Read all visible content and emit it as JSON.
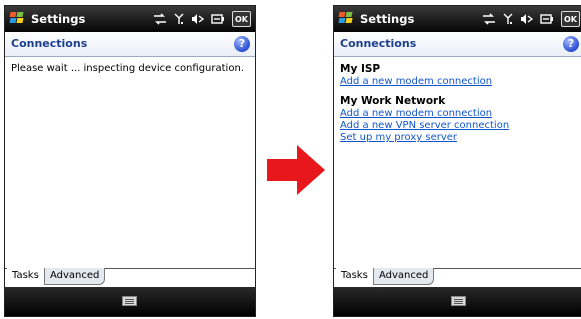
{
  "colors": {
    "title_bar": "#000000",
    "header_text": "#1b3f8e",
    "link": "#1155cc",
    "arrow": "#e8171b",
    "help_icon": "#2a4fd1"
  },
  "left_screen": {
    "title": "Settings",
    "ok_label": "OK",
    "header": "Connections",
    "message": "Please wait ... inspecting device configuration.",
    "tabs": [
      "Tasks",
      "Advanced"
    ]
  },
  "right_screen": {
    "title": "Settings",
    "ok_label": "OK",
    "header": "Connections",
    "groups": [
      {
        "title": "My ISP",
        "links": [
          "Add a new modem connection"
        ]
      },
      {
        "title": "My Work Network",
        "links": [
          "Add a new modem connection",
          "Add a new VPN server connection",
          "Set up my proxy server"
        ]
      }
    ],
    "tabs": [
      "Tasks",
      "Advanced"
    ]
  },
  "icons": [
    "windows-start-icon",
    "connectivity-icon",
    "signal-icon",
    "volume-icon",
    "battery-icon",
    "help-icon",
    "keyboard-icon",
    "right-arrow-icon"
  ]
}
